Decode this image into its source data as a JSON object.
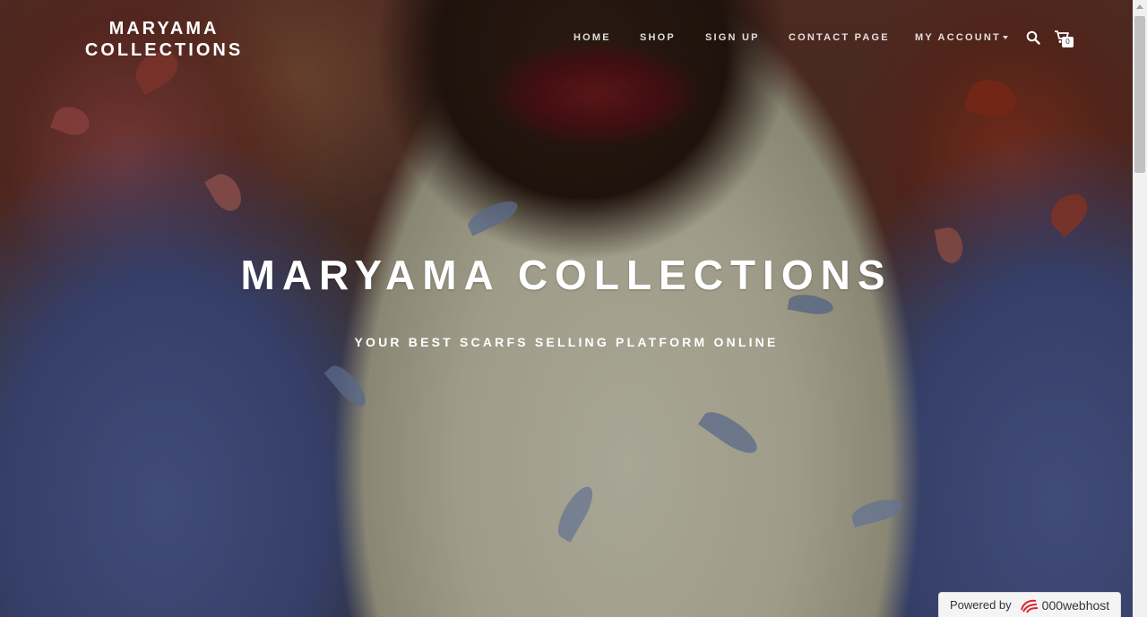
{
  "header": {
    "brand_line1": "MARYAMA",
    "brand_line2": "COLLECTIONS",
    "nav": [
      {
        "label": "HOME"
      },
      {
        "label": "SHOP"
      },
      {
        "label": "SIGN UP"
      },
      {
        "label": "CONTACT PAGE"
      },
      {
        "label": "MY ACCOUNT"
      }
    ],
    "cart_count": "0",
    "icons": {
      "search": "search-icon",
      "cart": "cart-icon"
    }
  },
  "hero": {
    "title": "MARYAMA COLLECTIONS",
    "subtitle": "YOUR BEST SCARFS SELLING PLATFORM ONLINE"
  },
  "footer_badge": {
    "label": "Powered by",
    "host": "000webhost"
  },
  "colors": {
    "nav_text": "#ffffff",
    "badge_bg": "#f4f4f4",
    "host_logo": "#d9232d"
  }
}
